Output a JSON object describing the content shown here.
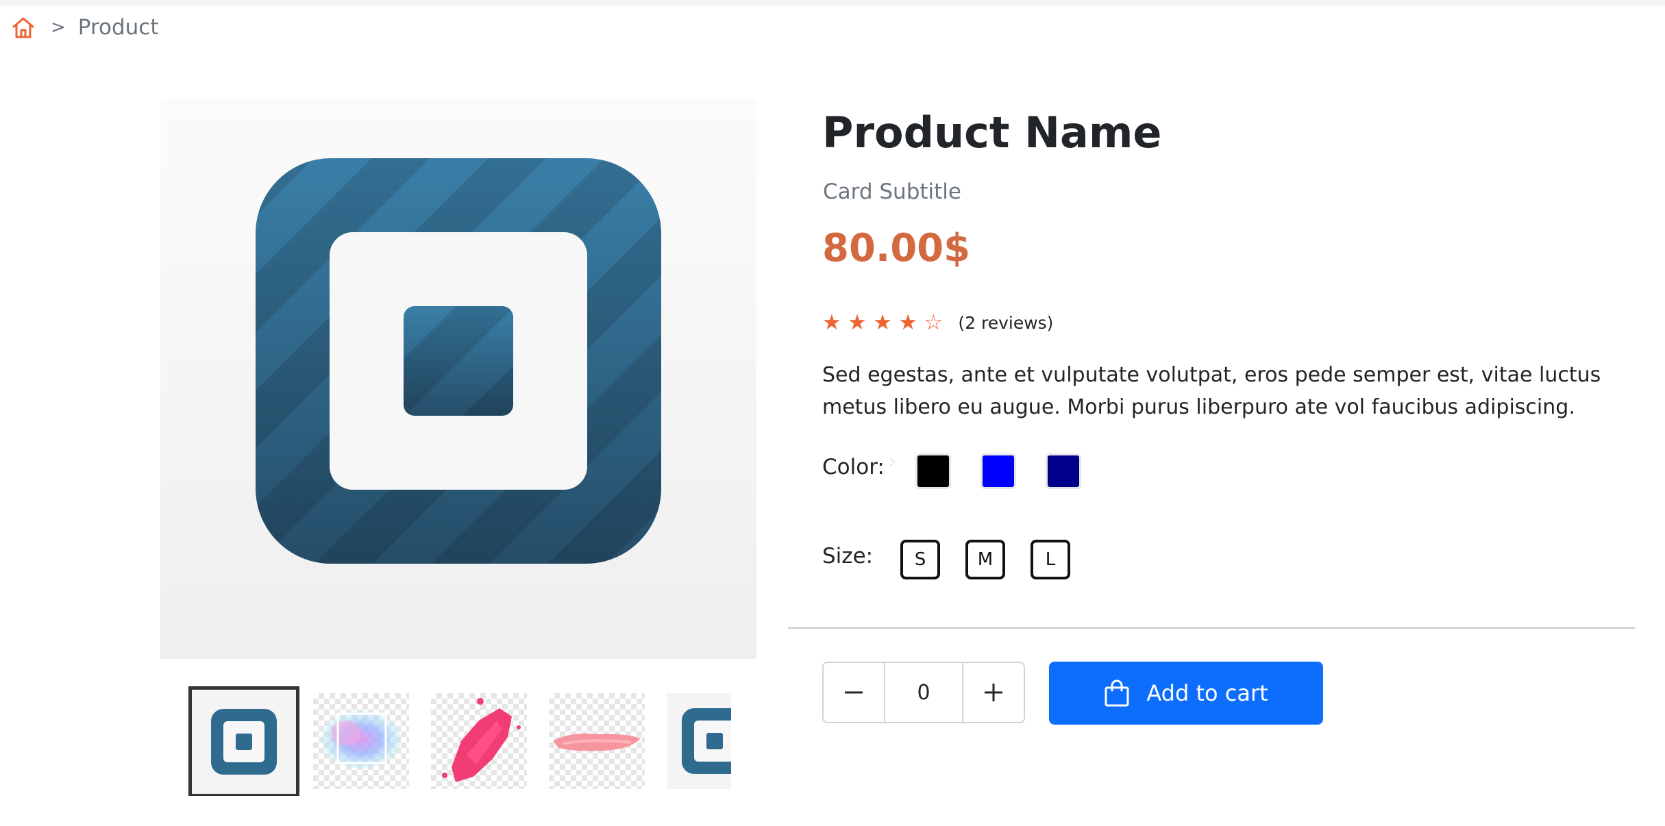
{
  "breadcrumb": {
    "home_icon": "home-icon",
    "separator": ">",
    "current": "Product"
  },
  "gallery": {
    "next_arrow": "›",
    "thumbnails": [
      "square-logo",
      "watercolor-frame",
      "pink-splatter",
      "pink-brush-stroke",
      "square-logo"
    ],
    "selected_index": 0
  },
  "product": {
    "name": "Product Name",
    "subtitle": "Card Subtitle",
    "price": "80.00$",
    "price_color": "#d2693f",
    "rating": {
      "value": 4.5,
      "max": 5,
      "star_color": "#ef6232",
      "reviews": "(2 reviews)"
    },
    "description": "Sed egestas, ante et vulputate volutpat, eros pede semper est, vitae luctus metus libero eu augue. Morbi purus liberpuro ate vol faucibus adipiscing."
  },
  "options": {
    "color_label": "Color:",
    "colors": [
      "#000000",
      "#0000ff",
      "#00008b"
    ],
    "size_label": "Size:",
    "sizes": [
      "S",
      "M",
      "L"
    ]
  },
  "cart": {
    "quantity": "0",
    "minus_icon": "minus-icon",
    "plus_icon": "plus-icon",
    "add_label": "Add to cart",
    "button_color": "#0d6efd",
    "cart_icon": "shopping-bag-icon"
  }
}
